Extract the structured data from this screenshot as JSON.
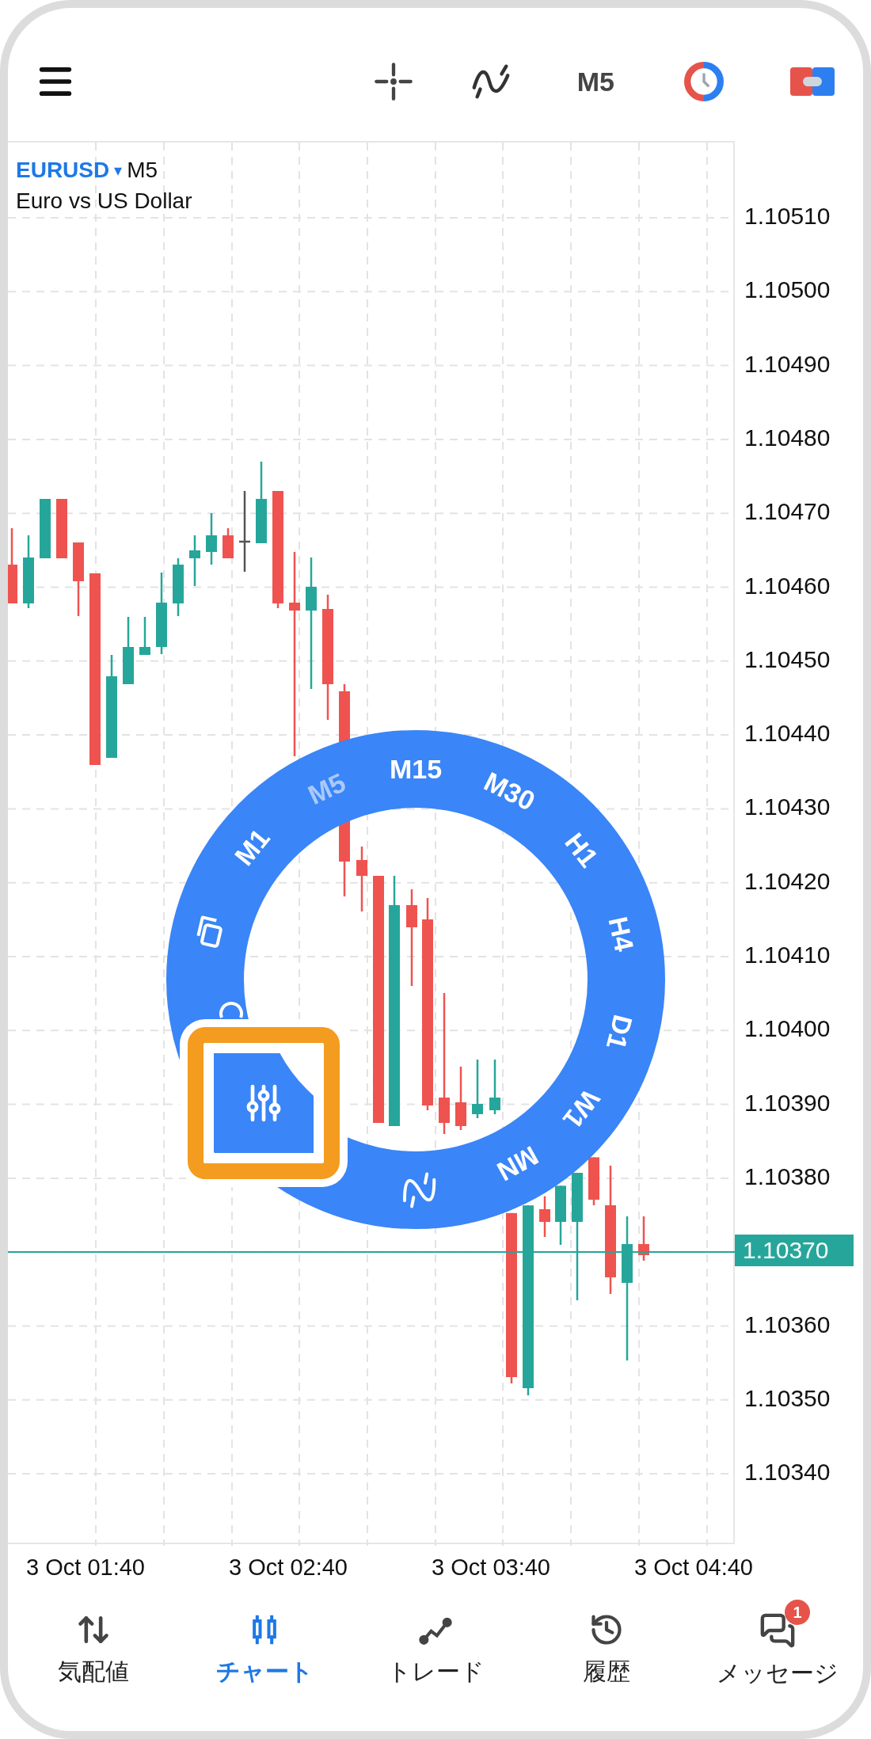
{
  "top_bar": {
    "timeframe": "M5"
  },
  "chart": {
    "symbol": "EURUSD",
    "symbol_arrow": "▾",
    "timeframe": "M5",
    "description": "Euro vs US Dollar",
    "price_axis": [
      {
        "kind": "tick",
        "label": "1.10510"
      },
      {
        "kind": "tick",
        "label": "1.10500"
      },
      {
        "kind": "tick",
        "label": "1.10490"
      },
      {
        "kind": "tick",
        "label": "1.10480"
      },
      {
        "kind": "tick",
        "label": "1.10470"
      },
      {
        "kind": "tick",
        "label": "1.10460"
      },
      {
        "kind": "tick",
        "label": "1.10450"
      },
      {
        "kind": "tick",
        "label": "1.10440"
      },
      {
        "kind": "tick",
        "label": "1.10430"
      },
      {
        "kind": "tick",
        "label": "1.10420"
      },
      {
        "kind": "tick",
        "label": "1.10410"
      },
      {
        "kind": "tick",
        "label": "1.10400"
      },
      {
        "kind": "tick",
        "label": "1.10390"
      },
      {
        "kind": "tick",
        "label": "1.10380"
      },
      {
        "kind": "current",
        "label": "1.10370"
      },
      {
        "kind": "tick",
        "label": "1.10360"
      },
      {
        "kind": "tick",
        "label": "1.10350"
      },
      {
        "kind": "tick",
        "label": "1.10340"
      }
    ],
    "time_axis": [
      "3 Oct 01:40",
      "3 Oct 02:40",
      "3 Oct 03:40",
      "3 Oct 04:40"
    ]
  },
  "timeframe_menu": {
    "options": [
      {
        "label": "M1",
        "selected": false
      },
      {
        "label": "M5",
        "selected": true
      },
      {
        "label": "M15",
        "selected": false
      },
      {
        "label": "M30",
        "selected": false
      },
      {
        "label": "H1",
        "selected": false
      },
      {
        "label": "H4",
        "selected": false
      },
      {
        "label": "D1",
        "selected": false
      },
      {
        "label": "W1",
        "selected": false
      },
      {
        "label": "MN",
        "selected": false
      }
    ]
  },
  "bottom_nav": [
    {
      "label": "気配値",
      "selected": false
    },
    {
      "label": "チャート",
      "selected": true
    },
    {
      "label": "トレード",
      "selected": false
    },
    {
      "label": "履歴",
      "selected": false
    },
    {
      "label": "メッセージ",
      "selected": false,
      "badge": "1"
    }
  ]
}
